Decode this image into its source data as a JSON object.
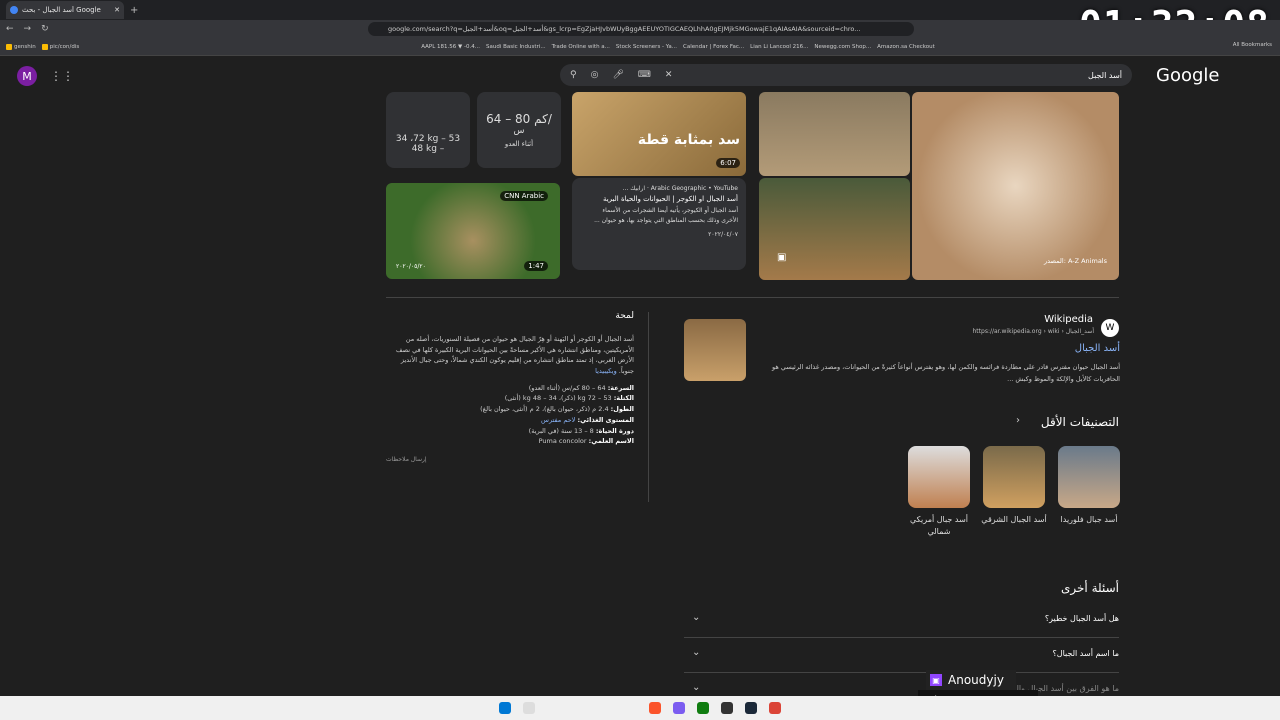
{
  "browser": {
    "tab_title": "أسد الجبال - بحث Google",
    "url": "google.com/search?q=أسد+الجبل&oq=أسد+الجبل&gs_lcrp=EgZjaHJvbWUyBggAEEUYOTIGCAEQLhhA0gEJMjk5MGowajE1qAIAsAIA&sourceid=chro...",
    "bookmarks": [
      "genshin",
      "pic/con/dis",
      "AAPL 181.56 ▼ -0.4...",
      "Saudi Basic Industri...",
      "Trade Online with a...",
      "Stock Screeners - Ya...",
      "Calendar | Forex Fac...",
      "Lian Li Lancool 216...",
      "Newegg.com Shop...",
      "Amazon.sa Checkout"
    ],
    "all_bookmarks": "All Bookmarks"
  },
  "overlay": {
    "timer": "01:32:08",
    "streamer": "Anoudyjy",
    "chat": "غشاش"
  },
  "header": {
    "avatar_letter": "M",
    "query": "أسد الجبل",
    "logo": "Google"
  },
  "stats": {
    "speed_value": "64 – 80 كم/",
    "speed_unit": "س",
    "speed_note": "أثناء العدو",
    "mass": "34 ،72 kg – 53",
    "mass2": "48 kg –"
  },
  "videos": {
    "cnn": {
      "source": "CNN Arabic",
      "duration": "1:47",
      "date": "٢٠٢٠/٠٥/٢٠"
    },
    "natgeo": {
      "overlay_text": "سد بمثابة قطة",
      "duration": "6:07",
      "meta": "Arabic Geographic • YouTube · ارابيك ...",
      "title": "أسد الجبال او الكوجر | الحيوانات والحياة البرية",
      "desc1": "أسد الجبال أو الكيوجر، يأتيه أيضا الشجرات من الأسماء",
      "desc2": "الأخرى وذلك بحسب المناطق التي يتواجد بها، هو حيوان ...",
      "date": "٢٠٢٢/٠٤/٠٧"
    },
    "source_label": "المصدر: A-Z Animals"
  },
  "overview": {
    "heading": "لمحة",
    "paragraph": "أسد الجبال أو الكوجر أو البَهنة أو هِرّ الجبال هو حيوان من فصيلة السنوريات، أصله من الأمريكيتين، ومناطق انتشاره هي الأكبر مساحةً بين الحيوانات البرية الكبيرة كلها في نصف الأرض الغربي، إذ تمتد مناطق انتشاره من إقليم يوكون الكندي شمالاً، وحتى جبال الأنديز جنوباً.",
    "wiki_link": "ويكيبيديا",
    "facts": [
      {
        "k": "السرعة:",
        "v": "64 – 80 كم/س (أثناء العدو)"
      },
      {
        "k": "الكتلة:",
        "v": "53 – 72 kg (ذكر)، 34 – 48 kg (أنثى)"
      },
      {
        "k": "الطول:",
        "v": "2.4 م (ذكر، حيوان بالغ)، 2 م (أنثى، حيوان بالغ)"
      },
      {
        "k": "المستوى الغذائي:",
        "v": "لاحم مفترس"
      },
      {
        "k": "دورة الحياة:",
        "v": "8 – 13 سنة (في البرية)"
      },
      {
        "k": "الاسم العلمي:",
        "v": "Puma concolor"
      }
    ],
    "feedback": "إرسال ملاحظات"
  },
  "wiki": {
    "logo": "W",
    "site": "Wikipedia",
    "url": "https://ar.wikipedia.org › wiki › أسد_الجبال",
    "title": "أسد الجبال",
    "desc": "أسد الجبال حيوان مفترس قادر على مطاردة فرائسه والكمن لها، وهو يفترس أنواعاً كثيرةً من الحيوانات، ومصدر غذائه الرئيسي هو الحافريات كالأيل والإلكة والموظ وكبش ..."
  },
  "classifications": {
    "heading": "التصنيفات الأقل",
    "items": [
      {
        "label": "أسد جبال فلوريدا"
      },
      {
        "label": "أسد الجبال الشرقي"
      },
      {
        "label": "أسد جبال أمريكي شمالي"
      }
    ]
  },
  "faq": {
    "heading": "أسئلة أخرى",
    "items": [
      "هل أسد الجبال خطير؟",
      "ما اسم أسد الجبال؟",
      "ما هو الفرق بين أسد الجبال والموس..."
    ]
  },
  "colors": {
    "accent": "#8ab4f8",
    "bg": "#1f1f1f",
    "card": "#303134"
  }
}
